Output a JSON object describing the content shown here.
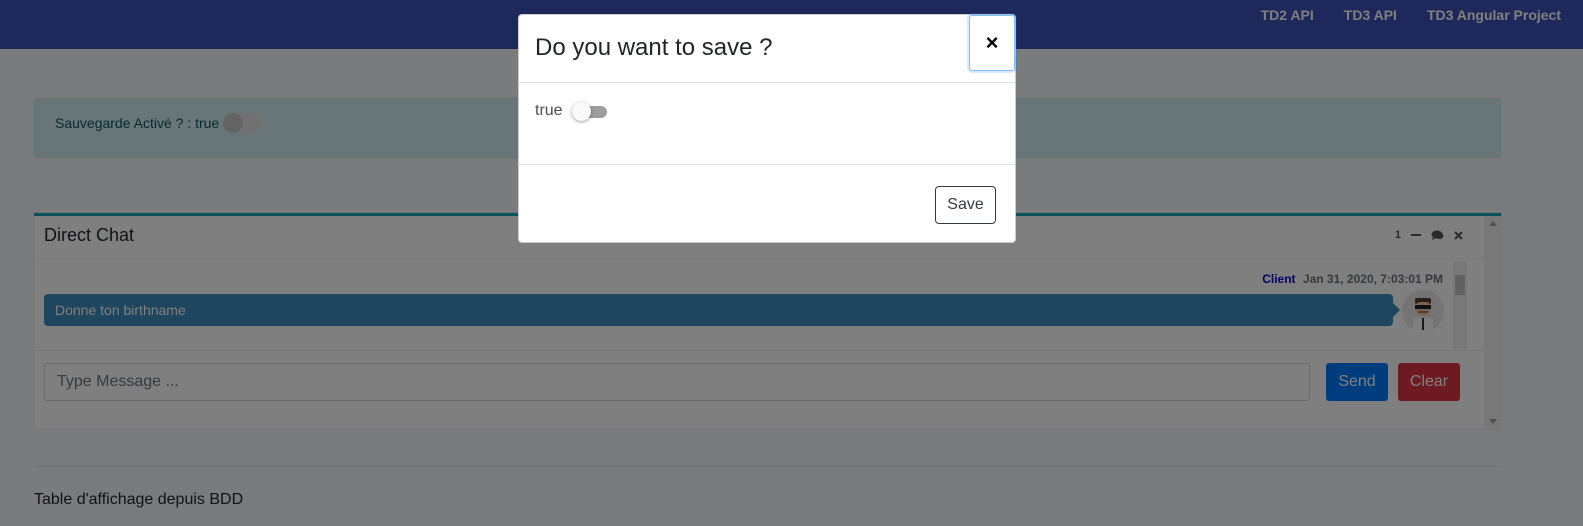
{
  "navbar": {
    "links": [
      "TD2 API",
      "TD3 API",
      "TD3 Angular Project"
    ],
    "color": "#3f51b5"
  },
  "save_alert": {
    "text": "Sauvegarde Activé ? : true",
    "switch_on": false
  },
  "chat": {
    "title": "Direct Chat",
    "badge_count": "1",
    "tools": [
      "minus-icon",
      "comments-icon",
      "close-icon"
    ],
    "messages": [
      {
        "sender": "Client",
        "time": "Jan 31, 2020, 7:03:01 PM",
        "text": "Donne ton birthname",
        "avatar": "user-avatar"
      }
    ],
    "input_placeholder": "Type Message ...",
    "send_label": "Send",
    "clear_label": "Clear",
    "accent": "#3c8dbc"
  },
  "section": {
    "title": "Table d'affichage depuis BDD"
  },
  "modal": {
    "title": "Do you want to save ?",
    "close_label": "×",
    "toggle_label": "true",
    "toggle_on": false,
    "save_label": "Save"
  }
}
